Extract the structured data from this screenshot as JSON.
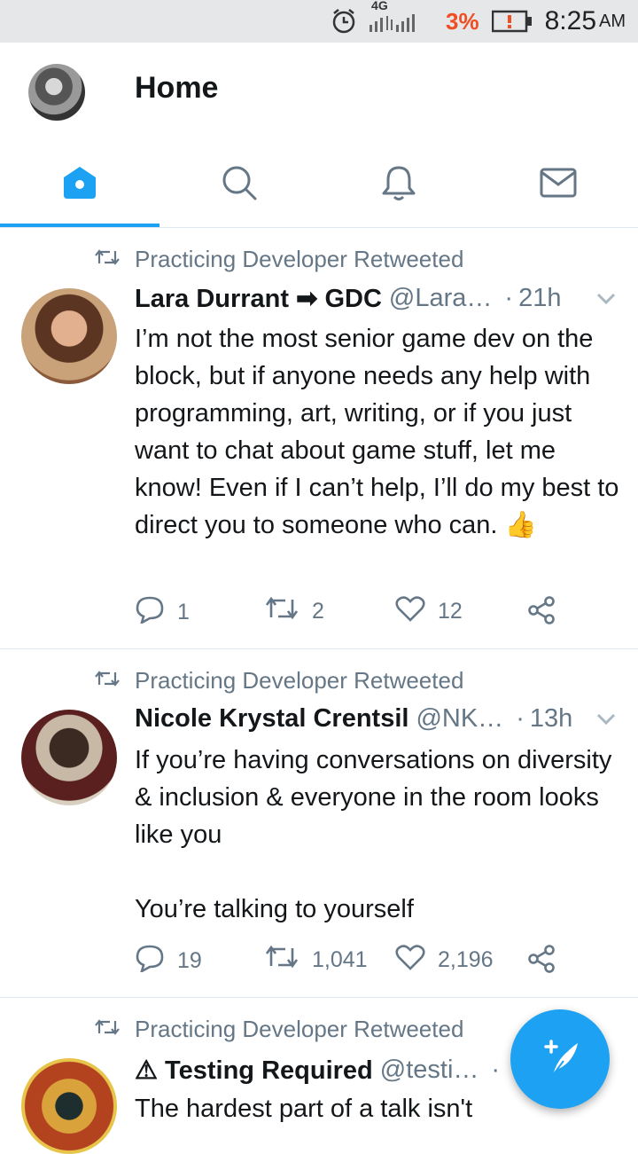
{
  "status_bar": {
    "network": "4G",
    "battery_percent": "3%",
    "time": "8:25",
    "ampm": "AM"
  },
  "header": {
    "title": "Home"
  },
  "tabs": [
    "home-icon",
    "search-icon",
    "notifications-icon",
    "messages-icon"
  ],
  "colors": {
    "accent": "#1da1f2",
    "muted": "#657786",
    "battery_low": "#ef4e23"
  },
  "tweets": [
    {
      "retweet_label": "Practicing Developer Retweeted",
      "name": "Lara Durrant ➡ GDC",
      "handle": "@Lara…",
      "dot": "·",
      "time": "21h",
      "text": "I’m not the most senior game dev on the block, but if anyone needs any help with programming, art, writing, or if you just want to chat about game stuff, let me know! Even if I can’t help, I’ll do my best to direct you to someone who can. 👍",
      "replies": "1",
      "retweets": "2",
      "likes": "12"
    },
    {
      "retweet_label": "Practicing Developer Retweeted",
      "name": "Nicole Krystal Crentsil",
      "handle": "@NK…",
      "dot": "·",
      "time": "13h",
      "text": "If you’re having conversations on diversity & inclusion & everyone in the room looks like you\n\nYou’re talking to yourself",
      "replies": "19",
      "retweets": "1,041",
      "likes": "2,196"
    },
    {
      "retweet_label": "Practicing Developer Retweeted",
      "name": "⚠ Testing Required",
      "handle": "@testi…",
      "dot": "·",
      "text": "The hardest part of a talk isn't"
    }
  ],
  "fab": {
    "icon": "compose-tweet-icon"
  }
}
